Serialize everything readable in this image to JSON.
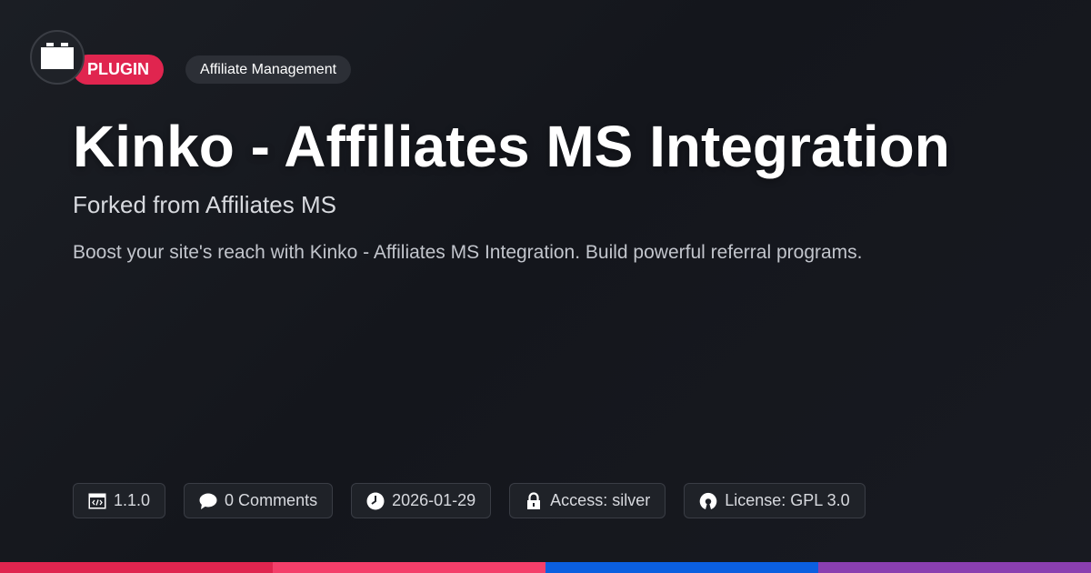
{
  "header": {
    "type_badge": "PLUGIN",
    "category_badge": "Affiliate Management",
    "logo_icon": "block-icon"
  },
  "main": {
    "title": "Kinko - Affiliates MS Integration",
    "subtitle": "Forked from Affiliates MS",
    "description": "Boost your site's reach with Kinko - Affiliates MS Integration. Build powerful referral programs."
  },
  "meta": {
    "version": "1.1.0",
    "comments": "0 Comments",
    "date": "2026-01-29",
    "access": "Access: silver",
    "license": "License: GPL 3.0"
  },
  "colors": {
    "accent": "#e0254f",
    "bar": [
      "#e0254f",
      "#f43f6a",
      "#0b5fe0",
      "#8a3fb0"
    ]
  }
}
